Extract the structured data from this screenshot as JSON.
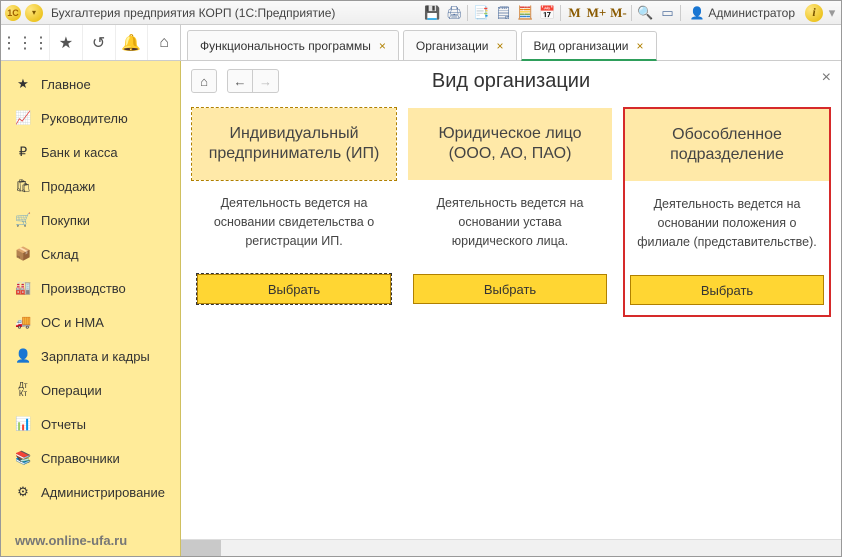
{
  "titlebar": {
    "app_label": "1С",
    "title": "Бухгалтерия предприятия КОРП  (1С:Предприятие)",
    "m1": "M",
    "m2": "M+",
    "m3": "M-",
    "user_label": "Администратор",
    "info_label": "i"
  },
  "tabs": [
    {
      "label": "Функциональность программы",
      "active": false
    },
    {
      "label": "Организации",
      "active": false
    },
    {
      "label": "Вид организации",
      "active": true
    }
  ],
  "sidebar": {
    "items": [
      {
        "icon": "★",
        "label": "Главное"
      },
      {
        "icon": "📈",
        "label": "Руководителю"
      },
      {
        "icon": "₽",
        "label": "Банк и касса"
      },
      {
        "icon": "🛍",
        "label": "Продажи"
      },
      {
        "icon": "🛒",
        "label": "Покупки"
      },
      {
        "icon": "📦",
        "label": "Склад"
      },
      {
        "icon": "🏭",
        "label": "Производство"
      },
      {
        "icon": "🚚",
        "label": "ОС и НМА"
      },
      {
        "icon": "👤",
        "label": "Зарплата и кадры"
      },
      {
        "icon": "Дт\nКт",
        "label": "Операции"
      },
      {
        "icon": "📊",
        "label": "Отчеты"
      },
      {
        "icon": "📚",
        "label": "Справочники"
      },
      {
        "icon": "⚙",
        "label": "Администрирование"
      }
    ],
    "footer": "www.online-ufa.ru"
  },
  "page": {
    "title": "Вид организации",
    "cards": [
      {
        "title": "Индивидуальный предприниматель (ИП)",
        "desc": "Деятельность ведется на основании свидетельства о регистрации ИП.",
        "button": "Выбрать",
        "selected": true,
        "highlight": false
      },
      {
        "title": "Юридическое лицо (ООО, АО, ПАО)",
        "desc": "Деятельность ведется на основании устава юридического лица.",
        "button": "Выбрать",
        "selected": false,
        "highlight": false
      },
      {
        "title": "Обособленное подразделение",
        "desc": "Деятельность ведется на основании положения о филиале (представительстве).",
        "button": "Выбрать",
        "selected": false,
        "highlight": true
      }
    ]
  }
}
